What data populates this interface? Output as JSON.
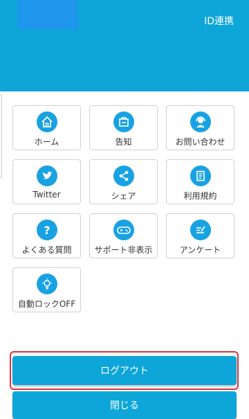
{
  "header": {
    "id_link_label": "ID連携"
  },
  "menu": [
    {
      "label": "ホーム",
      "icon": "home-icon"
    },
    {
      "label": "告知",
      "icon": "notice-bag-icon"
    },
    {
      "label": "お問い合わせ",
      "icon": "support-headset-icon"
    },
    {
      "label": "Twitter",
      "icon": "twitter-bird-icon"
    },
    {
      "label": "シェア",
      "icon": "share-icon"
    },
    {
      "label": "利用規約",
      "icon": "terms-document-icon"
    },
    {
      "label": "よくある質問",
      "icon": "question-mark-icon"
    },
    {
      "label": "サポート非表示",
      "icon": "gamepad-icon"
    },
    {
      "label": "アンケート",
      "icon": "survey-pencil-icon"
    },
    {
      "label": "自動ロックOFF",
      "icon": "lightbulb-icon"
    }
  ],
  "buttons": {
    "logout_label": "ログアウト",
    "close_label": "閉じる"
  },
  "colors": {
    "accent": "#0ea6d8",
    "icon": "#19a2e2",
    "highlight": "#d9343d"
  }
}
